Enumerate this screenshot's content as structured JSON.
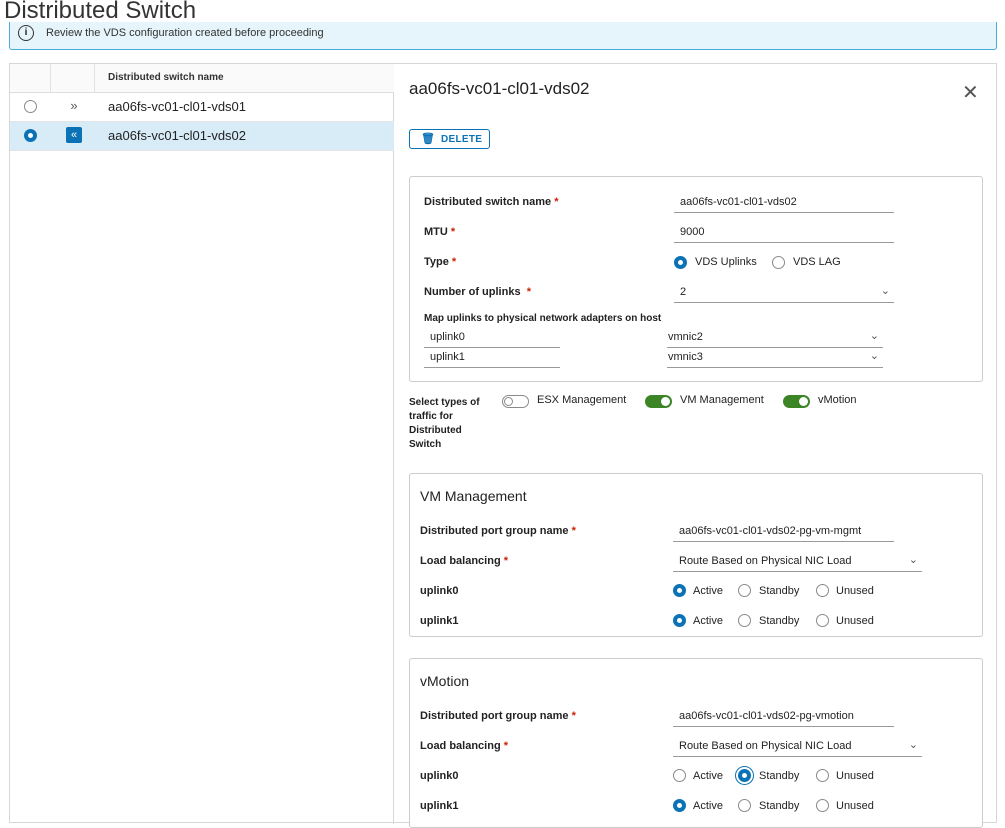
{
  "page": {
    "title": "Distributed Switch"
  },
  "alert": {
    "icon": "info-icon",
    "text": "Review the VDS configuration created before proceeding"
  },
  "grid": {
    "header": "Distributed switch name",
    "rows": [
      {
        "name": "aa06fs-vc01-cl01-vds01",
        "selected": false,
        "expander": "»"
      },
      {
        "name": "aa06fs-vc01-cl01-vds02",
        "selected": true,
        "expander": "«"
      }
    ]
  },
  "detail": {
    "title": "aa06fs-vc01-cl01-vds02",
    "close": "✕",
    "delete_label": "DELETE",
    "form": {
      "name_label": "Distributed switch name",
      "name_value": "aa06fs-vc01-cl01-vds02",
      "mtu_label": "MTU",
      "mtu_value": "9000",
      "type_label": "Type",
      "type_opt1": "VDS Uplinks",
      "type_opt2": "VDS LAG",
      "uplinks_label": "Number of uplinks",
      "uplinks_value": "2",
      "map_label": "Map uplinks to physical network adapters on host",
      "map": [
        {
          "uplink": "uplink0",
          "nic": "vmnic2"
        },
        {
          "uplink": "uplink1",
          "nic": "vmnic3"
        }
      ],
      "required_mark": "*"
    },
    "traffic": {
      "label": "Select types of traffic for Distributed Switch",
      "items": [
        {
          "label": "ESX Management",
          "on": false
        },
        {
          "label": "VM Management",
          "on": true
        },
        {
          "label": "vMotion",
          "on": true
        }
      ]
    },
    "vm_mgmt": {
      "title": "VM Management",
      "pg_label": "Distributed port group name",
      "pg_value": "aa06fs-vc01-cl01-vds02-pg-vm-mgmt",
      "lb_label": "Load balancing",
      "lb_value": "Route Based on Physical NIC Load",
      "uplinks": [
        {
          "name": "uplink0",
          "state": "Active"
        },
        {
          "name": "uplink1",
          "state": "Active"
        }
      ]
    },
    "vmotion": {
      "title": "vMotion",
      "pg_label": "Distributed port group name",
      "pg_value": "aa06fs-vc01-cl01-vds02-pg-vmotion",
      "lb_label": "Load balancing",
      "lb_value": "Route Based on Physical NIC Load",
      "uplinks": [
        {
          "name": "uplink0",
          "state": "Standby"
        },
        {
          "name": "uplink1",
          "state": "Active"
        }
      ]
    },
    "states": {
      "active": "Active",
      "standby": "Standby",
      "unused": "Unused"
    }
  },
  "colors": {
    "accent": "#0b72b5",
    "toggle_on": "#3c8527",
    "selected_row": "#d8ecf7",
    "alert_bg": "#e6f4fb"
  }
}
